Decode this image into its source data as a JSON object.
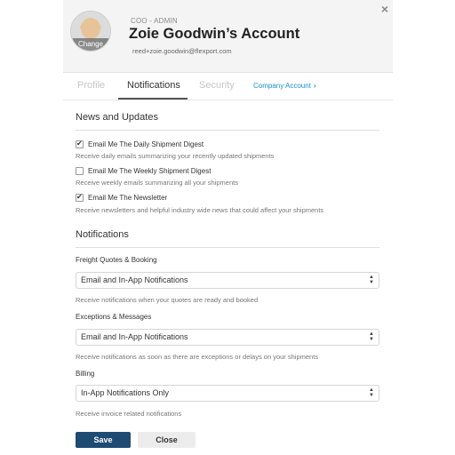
{
  "header": {
    "role": "COO - ADMIN",
    "title": "Zoie Goodwin’s Account",
    "email": "reed+zoie.goodwin@flexport.com",
    "avatar_change_label": "Change",
    "close_glyph": "×"
  },
  "tabs": [
    {
      "label": "Profile",
      "active": false
    },
    {
      "label": "Notifications",
      "active": true
    },
    {
      "label": "Security",
      "active": false
    }
  ],
  "company_link": {
    "label": "Company Account",
    "icon": "chevron-right-icon",
    "glyph": "›"
  },
  "news": {
    "heading": "News and Updates",
    "items": [
      {
        "label": "Email Me The Daily Shipment Digest",
        "checked": true,
        "help": "Receive daily emails summarizing your recently updated shipments"
      },
      {
        "label": "Email Me The Weekly Shipment Digest",
        "checked": false,
        "help": "Receive weekly emails summarizing all your shipments"
      },
      {
        "label": "Email Me The Newsletter",
        "checked": true,
        "help": "Receive newsletters and helpful industry wide news that could affect your shipments"
      }
    ]
  },
  "notifications": {
    "heading": "Notifications",
    "fields": [
      {
        "label": "Freight Quotes & Booking",
        "value": "Email and In-App Notifications",
        "help": "Receive notifications when your quotes are ready and booked"
      },
      {
        "label": "Exceptions & Messages",
        "value": "Email and In-App Notifications",
        "help": "Receive notifications as soon as there are exceptions or delays on your shipments"
      },
      {
        "label": "Billing",
        "value": "In-App Notifications Only",
        "help": "Receive invoice related notifications"
      }
    ]
  },
  "buttons": {
    "save": "Save",
    "close": "Close"
  },
  "colors": {
    "accent_link": "#1a8fd6",
    "save_button": "#1e4b72",
    "header_bg": "#f4f4f4"
  },
  "check_glyph": "✔"
}
